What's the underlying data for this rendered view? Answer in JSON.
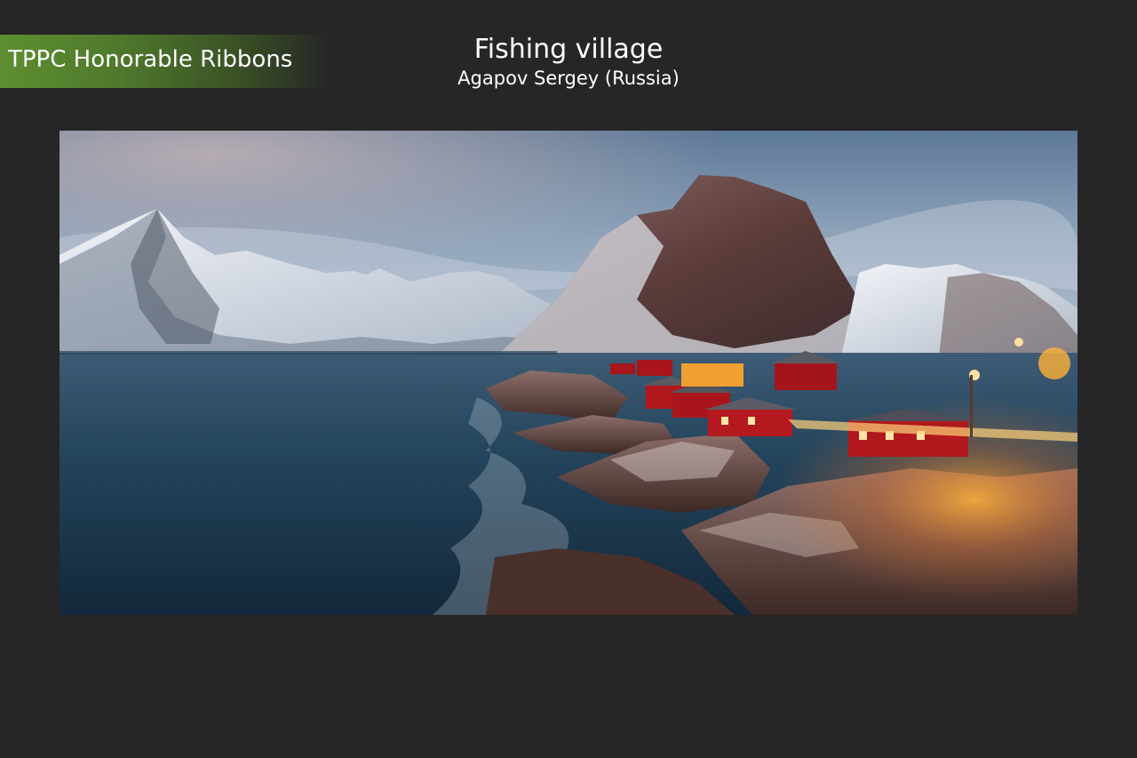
{
  "ribbon": {
    "label": "TPPC Honorable Ribbons",
    "color": "#5e8e30"
  },
  "photo": {
    "title": "Fishing village",
    "author": "Agapov Sergey  (Russia)"
  },
  "colors": {
    "background": "#262626",
    "sky": "#6f8aa6",
    "water": "#1e3a50",
    "house_red": "#b0181d",
    "light_glow": "#ffb23a"
  }
}
